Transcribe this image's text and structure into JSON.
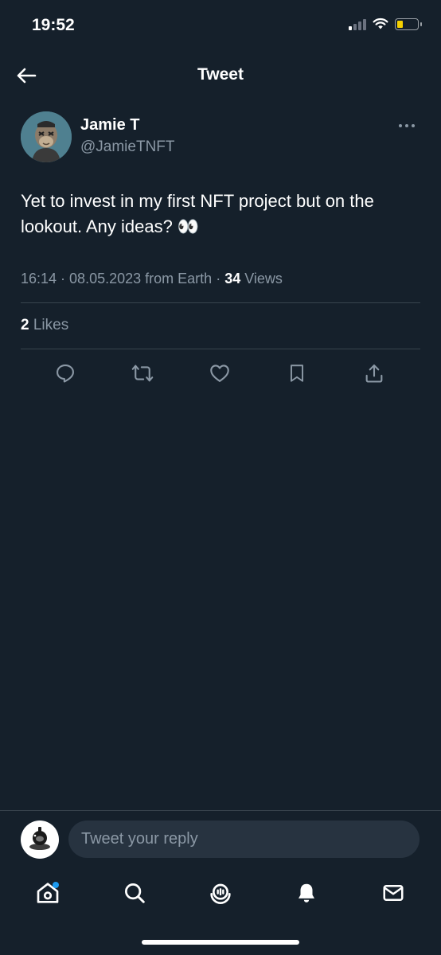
{
  "status_bar": {
    "time": "19:52"
  },
  "header": {
    "title": "Tweet"
  },
  "tweet": {
    "author_name": "Jamie T",
    "author_handle": "@JamieTNFT",
    "text": "Yet to invest in my first NFT project but on the lookout. Any ideas? 👀",
    "time": "16:14",
    "date": "08.05.2023",
    "source": "from Earth",
    "views_count": "34",
    "views_label": "Views",
    "likes_count": "2",
    "likes_label": "Likes"
  },
  "actions": [
    "reply-icon",
    "retweet-icon",
    "like-icon",
    "bookmark-icon",
    "share-icon"
  ],
  "reply": {
    "placeholder": "Tweet your reply"
  },
  "bottom_nav": [
    "home-icon",
    "search-icon",
    "spaces-icon",
    "notifications-icon",
    "messages-icon"
  ],
  "colors": {
    "background": "#15202b",
    "secondary_text": "#8b98a5",
    "divider": "#38444d",
    "accent": "#1d9bf0",
    "input_bg": "#273340"
  }
}
